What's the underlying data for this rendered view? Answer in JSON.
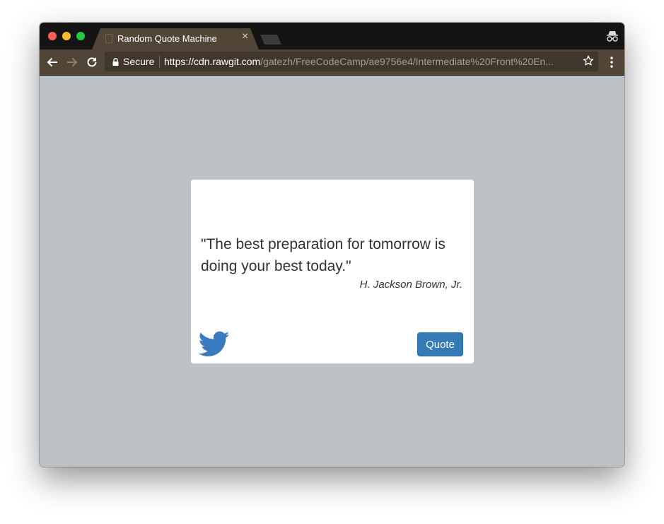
{
  "browser": {
    "tab": {
      "title": "Random Quote Machine",
      "close_glyph": "×"
    },
    "omnibox": {
      "security_label": "Secure",
      "url_host": "https://cdn.rawgit.com",
      "url_path": "/gatezh/FreeCodeCamp/ae9756e4/Intermediate%20Front%20En..."
    },
    "icons": {
      "back": "arrow-left-icon",
      "forward": "arrow-right-icon",
      "reload": "reload-icon",
      "lock": "lock-icon",
      "bookmark": "star-icon",
      "menu": "kebab-menu-icon",
      "incognito": "incognito-icon"
    }
  },
  "card": {
    "quote": "\"The best preparation for tomorrow is doing your best today.\"",
    "author": "H. Jackson Brown, Jr.",
    "quote_button_label": "Quote",
    "share_icon": "twitter-icon"
  },
  "colors": {
    "page_background": "#bdc2c6",
    "card_background": "#ffffff",
    "button_primary": "#337ab7",
    "twitter_blue": "#3a7bbf",
    "toolbar": "#514538"
  }
}
